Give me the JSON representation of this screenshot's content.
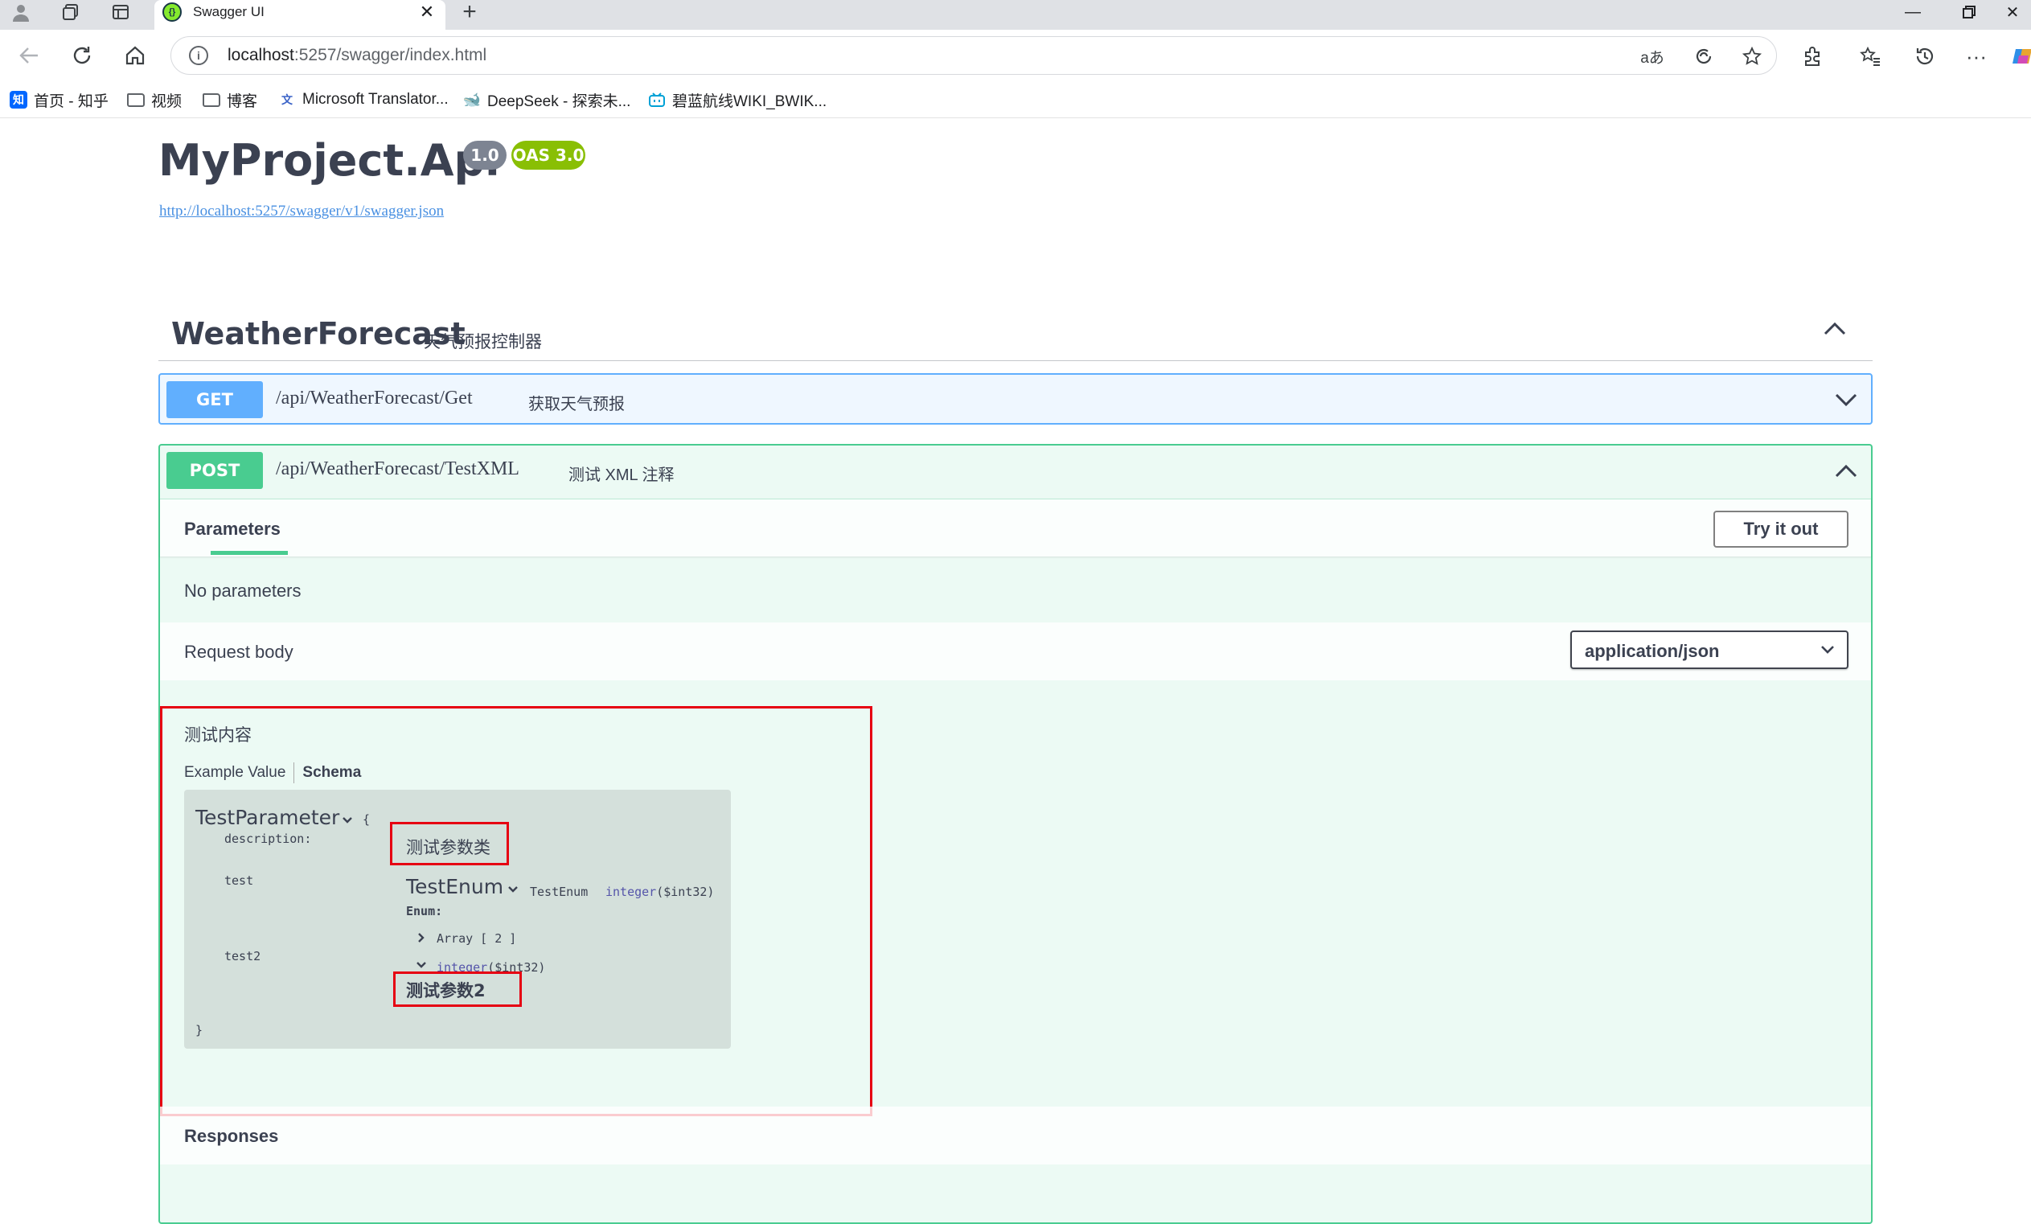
{
  "browser": {
    "tab_title": "Swagger UI",
    "url_host": "localhost",
    "url_rest": ":5257/swagger/index.html",
    "bookmarks": [
      {
        "label": "首页 - 知乎",
        "icon": "zhihu-icon"
      },
      {
        "label": "视频",
        "icon": "folder-icon"
      },
      {
        "label": "博客",
        "icon": "folder-icon"
      },
      {
        "label": "Microsoft Translator...",
        "icon": "translator-icon"
      },
      {
        "label": "DeepSeek - 探索未...",
        "icon": "deepseek-icon"
      },
      {
        "label": "碧蓝航线WIKI_BWIK...",
        "icon": "bilibili-icon"
      }
    ]
  },
  "api": {
    "title": "MyProject.Api",
    "version": "1.0",
    "oas": "OAS 3.0",
    "spec_url": "http://localhost:5257/swagger/v1/swagger.json"
  },
  "tag": {
    "name": "WeatherForecast",
    "description": "天气预报控制器"
  },
  "operations": [
    {
      "method": "GET",
      "path": "/api/WeatherForecast/Get",
      "summary": "获取天气预报",
      "color": "#61affe"
    },
    {
      "method": "POST",
      "path": "/api/WeatherForecast/TestXML",
      "summary": "测试 XML 注释",
      "color": "#49cc90"
    }
  ],
  "post_details": {
    "parameters_tab": "Parameters",
    "try_it_out": "Try it out",
    "no_parameters": "No parameters",
    "request_body_label": "Request body",
    "content_type": "application/json",
    "body_description": "测试内容",
    "example_value_tab": "Example Value",
    "schema_tab": "Schema",
    "responses_label": "Responses"
  },
  "schema": {
    "model_name": "TestParameter",
    "open_brace": "{",
    "close_brace": "}",
    "description_key": "description:",
    "description_value": "测试参数类",
    "prop_test": "test",
    "enum_name": "TestEnum",
    "enum_type_name": "TestEnum",
    "enum_type": "integer",
    "enum_format": "($int32)",
    "enum_label": "Enum:",
    "array_label": "Array [ 2 ]",
    "prop_test2": "test2",
    "test2_type": "integer",
    "test2_format": "($int32)",
    "test2_description": "测试参数2"
  },
  "colors": {
    "get": "#61affe",
    "post": "#49cc90",
    "version_badge": "#7d8492",
    "oas_badge": "#89bf04",
    "highlight_box": "#e60012"
  }
}
